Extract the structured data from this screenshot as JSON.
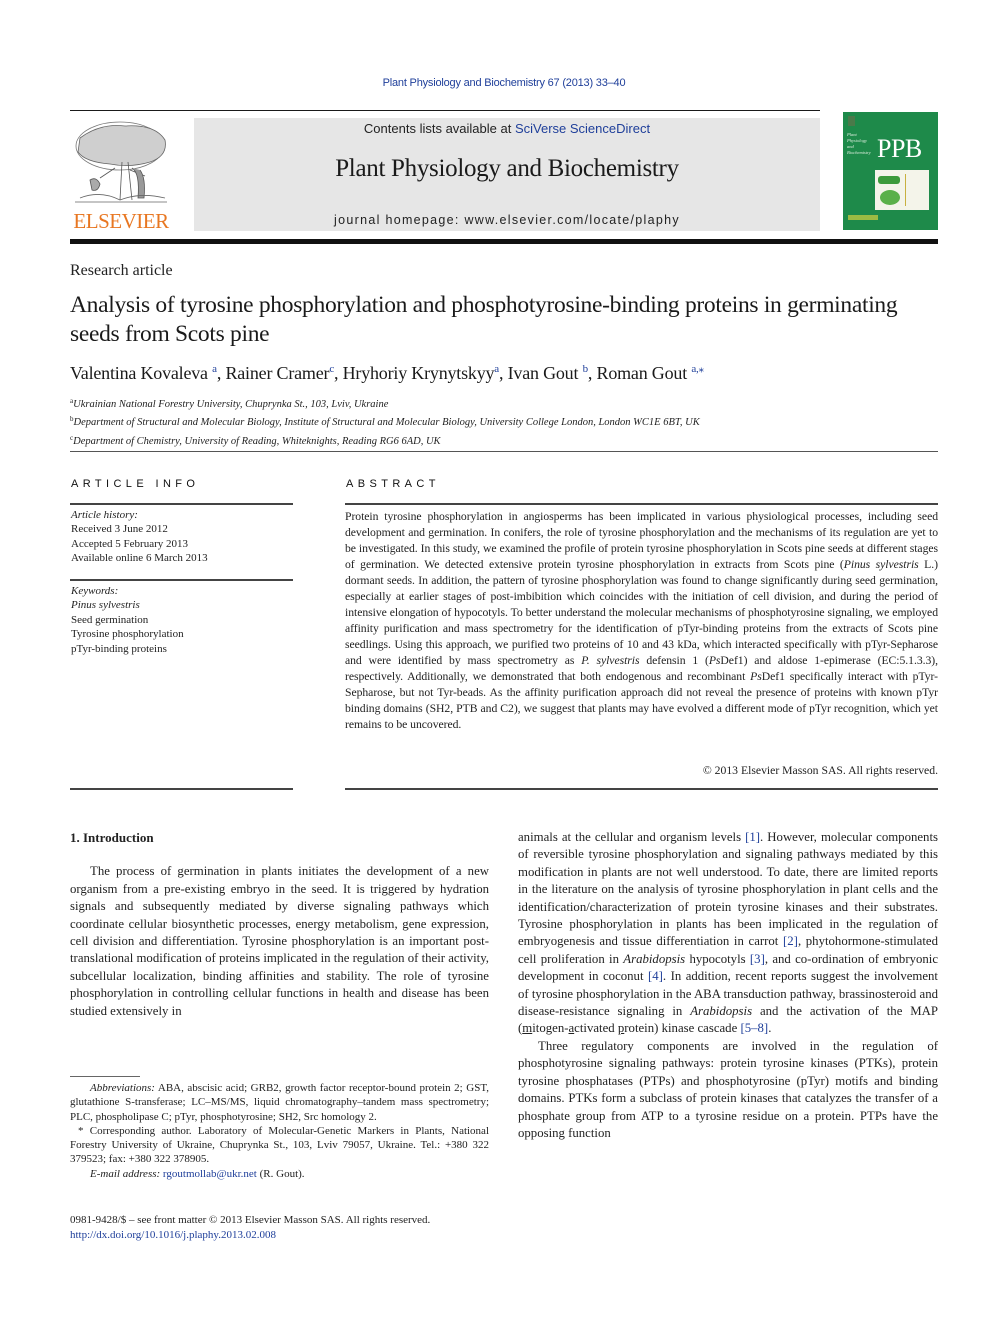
{
  "header": {
    "citation": "Plant Physiology and Biochemistry 67 (2013) 33–40",
    "contents_prefix": "Contents lists available at ",
    "contents_link": "SciVerse ScienceDirect",
    "journal_title": "Plant Physiology and Biochemistry",
    "homepage": "journal homepage: www.elsevier.com/locate/plaphy",
    "publisher_logo_text": "ELSEVIER",
    "cover": {
      "abbrev": "PPB",
      "subtitle_lines": [
        "Plant",
        "Physiology",
        "and",
        "Biochemistry"
      ],
      "background_color": "#1e8a4a"
    }
  },
  "article": {
    "type": "Research article",
    "title": "Analysis of tyrosine phosphorylation and phosphotyrosine-binding proteins in germinating seeds from Scots pine",
    "authors": [
      {
        "name": "Valentina Kovaleva",
        "aff": "a"
      },
      {
        "name": "Rainer Cramer",
        "aff": "c"
      },
      {
        "name": "Hryhoriy Krynytskyy",
        "aff": "a"
      },
      {
        "name": "Ivan Gout",
        "aff": "b"
      },
      {
        "name": "Roman Gout",
        "aff": "a,⁎"
      }
    ],
    "affiliations": [
      {
        "key": "a",
        "text": "Ukrainian National Forestry University, Chuprynka St., 103, Lviv, Ukraine"
      },
      {
        "key": "b",
        "text": "Department of Structural and Molecular Biology, Institute of Structural and Molecular Biology, University College London, London WC1E 6BT, UK"
      },
      {
        "key": "c",
        "text": "Department of Chemistry, University of Reading, Whiteknights, Reading RG6 6AD, UK"
      }
    ]
  },
  "article_info": {
    "label": "ARTICLE INFO",
    "history_label": "Article history:",
    "history": [
      "Received 3 June 2012",
      "Accepted 5 February 2013",
      "Available online 6 March 2013"
    ],
    "keywords_label": "Keywords:",
    "keywords": [
      "Pinus sylvestris",
      "Seed germination",
      "Tyrosine phosphorylation",
      "pTyr-binding proteins"
    ]
  },
  "abstract": {
    "label": "ABSTRACT",
    "p1": "Protein tyrosine phosphorylation in angiosperms has been implicated in various physiological processes, including seed development and germination. In conifers, the role of tyrosine phosphorylation and the mechanisms of its regulation are yet to be investigated. In this study, we examined the profile of protein tyrosine phosphorylation in Scots pine seeds at different stages of germination. We detected extensive protein tyrosine phosphorylation in extracts from Scots pine (",
    "i1": "Pinus sylvestris",
    "p2": " L.) dormant seeds. In addition, the pattern of tyrosine phosphorylation was found to change significantly during seed germination, especially at earlier stages of post-imbibition which coincides with the initiation of cell division, and during the period of intensive elongation of hypocotyls. To better understand the molecular mechanisms of phosphotyrosine signaling, we employed affinity purification and mass spectrometry for the identification of pTyr-binding proteins from the extracts of Scots pine seedlings. Using this approach, we purified two proteins of 10 and 43 kDa, which interacted specifically with pTyr-Sepharose and were identified by mass spectrometry as ",
    "i2": "P. sylvestris",
    "p3": " defensin 1 (",
    "i3": "Ps",
    "p4": "Def1) and aldose 1-epimerase (EC:5.1.3.3), respectively. Additionally, we demonstrated that both endogenous and recombinant ",
    "i4": "Ps",
    "p5": "Def1 specifically interact with pTyr-Sepharose, but not Tyr-beads. As the affinity purification approach did not reveal the presence of proteins with known pTyr binding domains (SH2, PTB and C2), we suggest that plants may have evolved a different mode of pTyr recognition, which yet remains to be uncovered.",
    "copyright": "© 2013 Elsevier Masson SAS. All rights reserved."
  },
  "introduction": {
    "heading": "1.  Introduction",
    "left_p1": "The process of germination in plants initiates the development of a new organism from a pre-existing embryo in the seed. It is triggered by hydration signals and subsequently mediated by diverse signaling pathways which coordinate cellular biosynthetic processes, energy metabolism, gene expression, cell division and differentiation. Tyrosine phosphorylation is an important post-translational modification of proteins implicated in the regulation of their activity, subcellular localization, binding affinities and stability. The role of tyrosine phosphorylation in controlling cellular functions in health and disease has been studied extensively in",
    "right": {
      "s1": "animals at the cellular and organism levels ",
      "r1": "[1]",
      "s2": ". However, molecular components of reversible tyrosine phosphorylation and signaling pathways mediated by this modification in plants are not well understood. To date, there are limited reports in the literature on the analysis of tyrosine phosphorylation in plant cells and the identification/characterization of protein tyrosine kinases and their substrates. Tyrosine phosphorylation in plants has been implicated in the regulation of embryogenesis and tissue differentiation in carrot ",
      "r2": "[2]",
      "s3": ", phytohormone-stimulated cell proliferation in ",
      "i1": "Arabidopsis",
      "s4": " hypocotyls ",
      "r3": "[3]",
      "s5": ", and co-ordination of embryonic development in coconut ",
      "r4": "[4]",
      "s6": ". In addition, recent reports suggest the involvement of tyrosine phosphorylation in the ABA transduction pathway, brassinosteroid and disease-resistance signaling in ",
      "i2": "Arabidopsis",
      "s7": " and the activation of the MAP (",
      "u1": "m",
      "s8": "itogen-",
      "u2": "a",
      "s9": "ctivated ",
      "u3": "p",
      "s10": "rotein) kinase cascade ",
      "r5": "[5–8]",
      "s11": ".",
      "p2": "Three regulatory components are involved in the regulation of phosphotyrosine signaling pathways: protein tyrosine kinases (PTKs), protein tyrosine phosphatases (PTPs) and phosphotyrosine (pTyr) motifs and binding domains. PTKs form a subclass of protein kinases that catalyzes the transfer of a phosphate group from ATP to a tyrosine residue on a protein. PTPs have the opposing function"
    }
  },
  "footnotes": {
    "abbrev_label": "Abbreviations:",
    "abbrev_text": " ABA, abscisic acid; GRB2, growth factor receptor-bound protein 2; GST, glutathione S-transferase; LC–MS/MS, liquid chromatography–tandem mass spectrometry; PLC, phospholipase C; pTyr, phosphotyrosine; SH2, Src homology 2.",
    "corresponding": "* Corresponding author. Laboratory of Molecular-Genetic Markers in Plants, National Forestry University of Ukraine, Chuprynka St., 103, Lviv 79057, Ukraine. Tel.: +380 322 379523; fax: +380 322 378905.",
    "email_label": "E-mail address:",
    "email": "rgoutmollab@ukr.net",
    "email_suffix": " (R. Gout).",
    "front_matter": "0981-9428/$ – see front matter © 2013 Elsevier Masson SAS. All rights reserved.",
    "doi": "http://dx.doi.org/10.1016/j.plaphy.2013.02.008"
  }
}
